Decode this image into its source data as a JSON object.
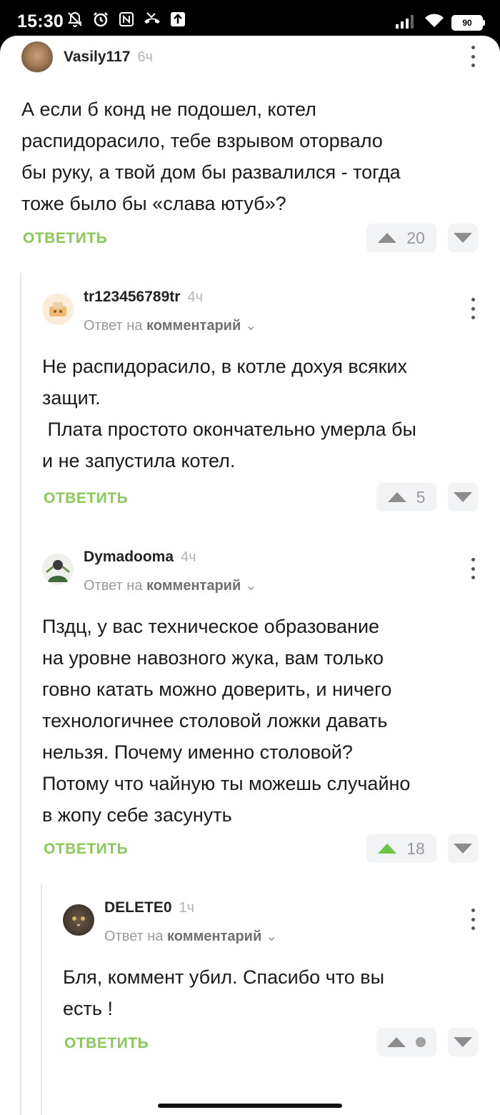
{
  "status_bar": {
    "time": "15:30",
    "battery": "90"
  },
  "comments": [
    {
      "username": "Vasily117",
      "time": "6ч",
      "text_lines": [
        "А если б конд не подошел, котел",
        "распидорасило, тебе взрывом оторвало",
        "бы руку, а твой дом бы развалился - тогда",
        "тоже было бы «слава ютуб»?"
      ],
      "reply_label": "ОТВЕТИТЬ",
      "score": "20"
    },
    {
      "username": "tr123456789tr",
      "time": "4ч",
      "reply_prefix": "Ответ на",
      "reply_target": "комментарий",
      "text_lines": [
        "Не распидорасило, в котле дохуя всяких",
        "защит.",
        " Плата простото окончательно умерла бы",
        "и не запустила котел."
      ],
      "reply_label": "ОТВЕТИТЬ",
      "score": "5"
    },
    {
      "username": "Dymadooma",
      "time": "4ч",
      "reply_prefix": "Ответ на",
      "reply_target": "комментарий",
      "text_lines": [
        "Пздц, у вас техническое образование",
        "на уровне навозного жука, вам только",
        "говно катать можно доверить, и ничего",
        "технологичнее столовой ложки давать",
        "нельзя. Почему именно столовой?",
        "Потому что чайную ты можешь случайно",
        "в жопу себе засунуть"
      ],
      "reply_label": "ОТВЕТИТЬ",
      "score": "18"
    },
    {
      "username": "DELETE0",
      "time": "1ч",
      "reply_prefix": "Ответ на",
      "reply_target": "комментарий",
      "text_lines": [
        "Бля, коммент убил. Спасибо что вы",
        "есть !"
      ],
      "reply_label": "ОТВЕТИТЬ",
      "score": ""
    }
  ],
  "colors": {
    "accent_green": "#8ac858",
    "upvote_active": "#6cc644"
  }
}
